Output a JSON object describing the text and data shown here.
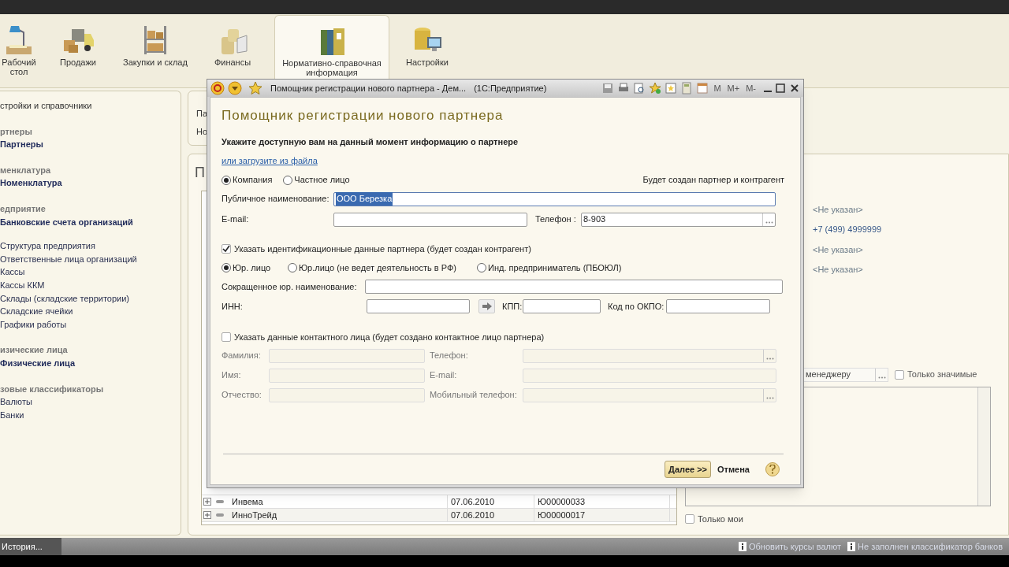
{
  "sections": [
    {
      "label": "Рабочий стол",
      "selected": false
    },
    {
      "label": "Продажи",
      "selected": false
    },
    {
      "label": "Закупки и склад",
      "selected": false
    },
    {
      "label": "Финансы",
      "selected": false
    },
    {
      "label": "Нормативно-справочная информация",
      "selected": true
    },
    {
      "label": "Настройки",
      "selected": false
    }
  ],
  "nav": [
    {
      "kind": "top",
      "text": "стройки и справочники"
    },
    {
      "kind": "group",
      "text": "ртнеры"
    },
    {
      "kind": "main",
      "text": "Партнеры"
    },
    {
      "kind": "group",
      "text": "менклатура"
    },
    {
      "kind": "main",
      "text": "Номенклатура"
    },
    {
      "kind": "group",
      "text": "едприятие"
    },
    {
      "kind": "main",
      "text": "Банковские счета организаций"
    },
    {
      "kind": "link",
      "text": "Структура предприятия"
    },
    {
      "kind": "link",
      "text": "Ответственные лица организаций"
    },
    {
      "kind": "link",
      "text": "Кассы"
    },
    {
      "kind": "link",
      "text": "Кассы ККМ"
    },
    {
      "kind": "link",
      "text": "Склады (складские территории)"
    },
    {
      "kind": "link",
      "text": "Складские ячейки"
    },
    {
      "kind": "link",
      "text": "Графики работы"
    },
    {
      "kind": "group",
      "text": "изические лица"
    },
    {
      "kind": "main",
      "text": "Физические лица"
    },
    {
      "kind": "group",
      "text": "зовые классификаторы"
    },
    {
      "kind": "link",
      "text": "Валюты"
    },
    {
      "kind": "link",
      "text": "Банки"
    }
  ],
  "top_panel": {
    "lines": [
      "Па",
      "Но"
    ]
  },
  "list_panel": {
    "heading": "П",
    "rows": [
      {
        "name": "Инвема",
        "date": "07.06.2010",
        "code": "Ю00000033"
      },
      {
        "name": "ИнноТрейд",
        "date": "07.06.2010",
        "code": "Ю00000017"
      }
    ]
  },
  "details": [
    {
      "kind": "empty",
      "text": "<Не указан>"
    },
    {
      "kind": "value",
      "text": "+7 (499) 4999999"
    },
    {
      "kind": "empty",
      "text": "<Не указан>"
    },
    {
      "kind": "empty",
      "text": "<Не указан>"
    }
  ],
  "manager_filter": {
    "value": "менеджеру"
  },
  "only_important": {
    "label": "Только значимые",
    "checked": false
  },
  "only_mine": {
    "label": "Только мои",
    "checked": false
  },
  "taskbar": {
    "button": "История...",
    "notices": [
      "Обновить курсы валют",
      "Не заполнен классификатор банков"
    ]
  },
  "dialog": {
    "title": "Помощник регистрации нового партнера - Дем...",
    "app": "(1С:Предприятие)",
    "memory_buttons": [
      "M",
      "M+",
      "M-"
    ],
    "heading": "Помощник регистрации нового партнера",
    "instruction": "Укажите доступную вам на данный момент информацию о партнере",
    "load_link": "или загрузите из файла",
    "partner_types": [
      {
        "label": "Компания",
        "selected": true
      },
      {
        "label": "Частное лицо",
        "selected": false
      }
    ],
    "result_note": "Будет создан партнер и контрагент",
    "public_name": {
      "label": "Публичное наименование:",
      "value": "ООО Березка"
    },
    "email": {
      "label": "E-mail:"
    },
    "phone": {
      "label": "Телефон :",
      "value": "8-903"
    },
    "identification": {
      "label": "Указать идентификационные данные партнера (будет создан контрагент)",
      "checked": true
    },
    "legal_types": [
      {
        "label": "Юр. лицо",
        "selected": true
      },
      {
        "label": "Юр.лицо (не ведет деятельность в РФ)",
        "selected": false
      },
      {
        "label": "Инд. предприниматель (ПБОЮЛ)",
        "selected": false
      }
    ],
    "short_name": {
      "label": "Сокращенное юр. наименование:"
    },
    "inn": {
      "label": "ИНН:"
    },
    "kpp": {
      "label": "КПП:"
    },
    "okpo": {
      "label": "Код по ОКПО:"
    },
    "contact": {
      "label": "Указать данные контактного лица (будет создано контактное лицо партнера)",
      "checked": false
    },
    "contact_fields": [
      {
        "label": "Фамилия:",
        "picker": false
      },
      {
        "label": "Телефон:",
        "picker": true
      },
      {
        "label": "Имя:",
        "picker": false
      },
      {
        "label": "E-mail:",
        "picker": false
      },
      {
        "label": "Отчество:",
        "picker": false
      },
      {
        "label": "Мобильный телефон:",
        "picker": true
      }
    ],
    "next_button": "Далее >>",
    "cancel_button": "Отмена"
  }
}
